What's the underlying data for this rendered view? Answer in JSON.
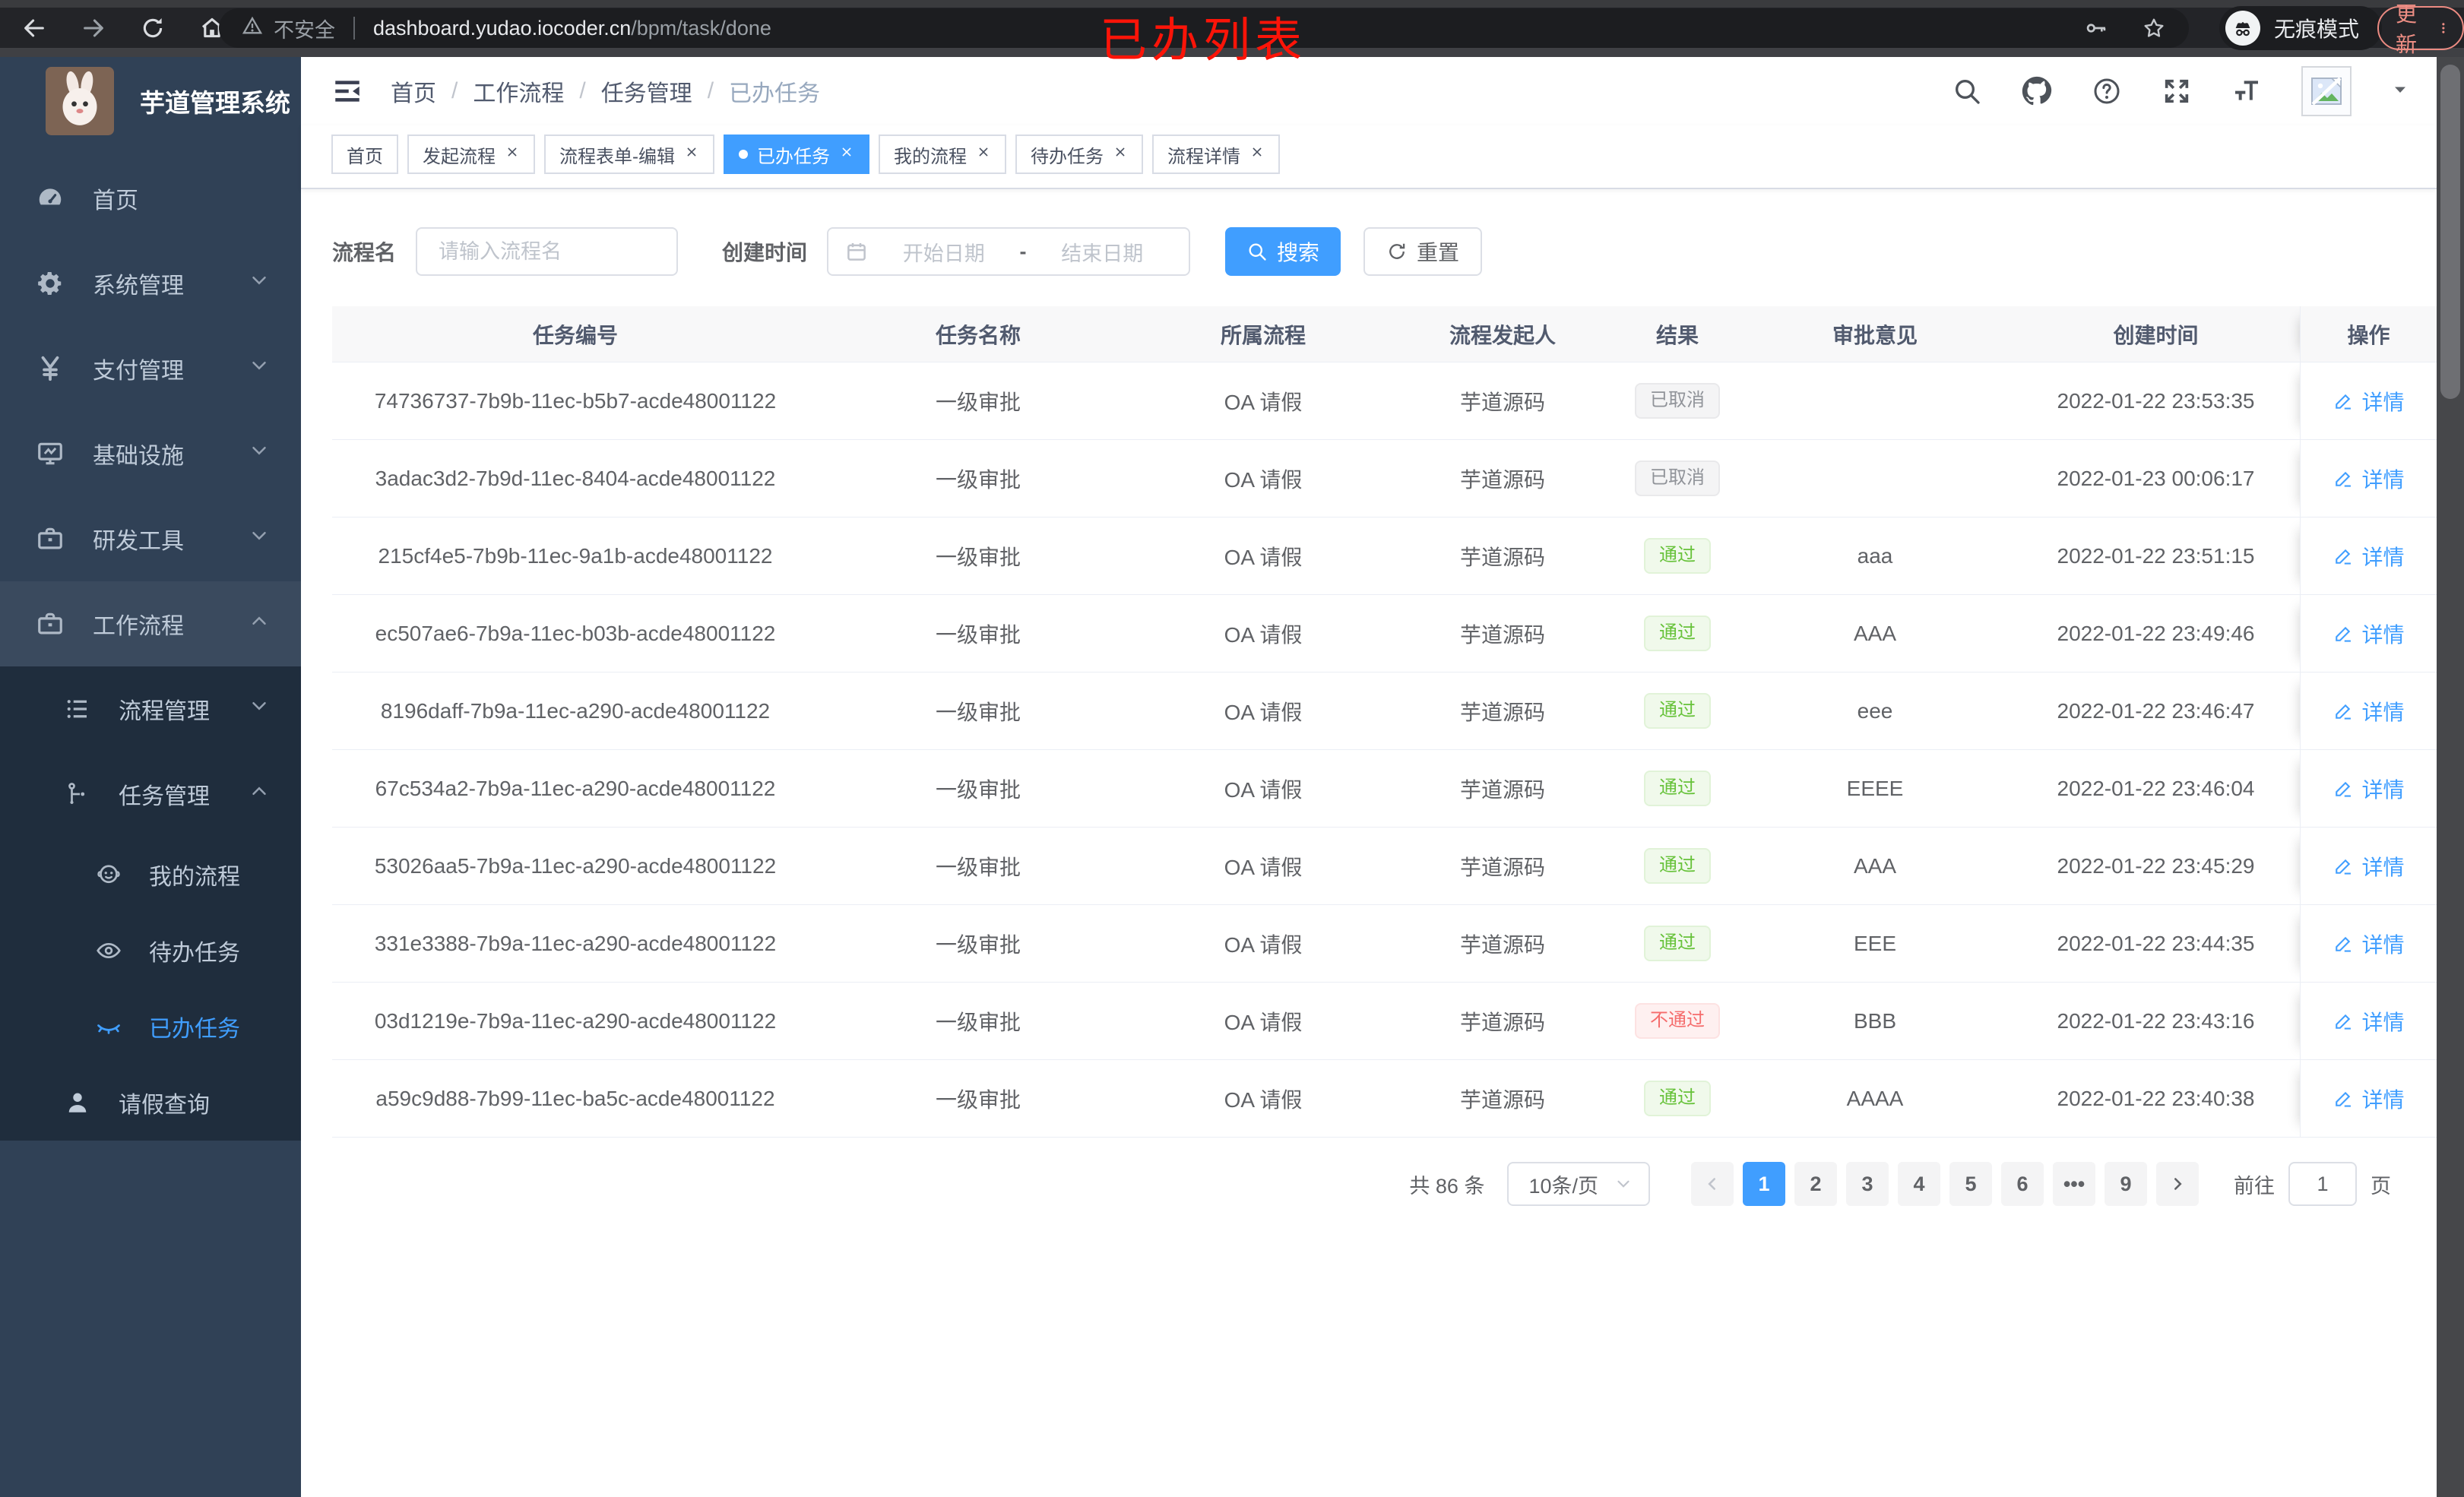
{
  "browser": {
    "security": "不安全",
    "url_domain": "dashboard.yudao.iocoder.cn",
    "url_path": "/bpm/task/done",
    "incognito": "无痕模式",
    "update": "更新"
  },
  "annotation": "已办列表",
  "colors": {
    "accent": "#409EFF",
    "success": "#67c23a",
    "danger": "#f56c6c",
    "info": "#909399",
    "sidebar_bg": "#304156",
    "submenu_bg": "#1f2d3d"
  },
  "sidebar": {
    "title": "芋道管理系统",
    "menu": {
      "home": "首页",
      "system": "系统管理",
      "pay": "支付管理",
      "infra": "基础设施",
      "dev": "研发工具",
      "workflow": "工作流程",
      "process_mgmt": "流程管理",
      "task_mgmt": "任务管理",
      "my_process": "我的流程",
      "todo": "待办任务",
      "done": "已办任务",
      "leave_query": "请假查询"
    }
  },
  "header": {
    "breadcrumb": [
      "首页",
      "工作流程",
      "任务管理",
      "已办任务"
    ]
  },
  "tabs": [
    {
      "label": "首页"
    },
    {
      "label": "发起流程"
    },
    {
      "label": "流程表单-编辑"
    },
    {
      "label": "已办任务"
    },
    {
      "label": "我的流程"
    },
    {
      "label": "待办任务"
    },
    {
      "label": "流程详情"
    }
  ],
  "filters": {
    "name_label": "流程名",
    "name_placeholder": "请输入流程名",
    "date_label": "创建时间",
    "date_start": "开始日期",
    "date_sep": "-",
    "date_end": "结束日期",
    "search": "搜索",
    "reset": "重置"
  },
  "table": {
    "columns": [
      "任务编号",
      "任务名称",
      "所属流程",
      "流程发起人",
      "结果",
      "审批意见",
      "创建时间",
      "操作"
    ],
    "action": "详情",
    "rows": [
      {
        "id": "74736737-7b9b-11ec-b5b7-acde48001122",
        "name": "一级审批",
        "flow": "OA 请假",
        "starter": "芋道源码",
        "result": "已取消",
        "result_type": "info",
        "comment": "",
        "time": "2022-01-22 23:53:35"
      },
      {
        "id": "3adac3d2-7b9d-11ec-8404-acde48001122",
        "name": "一级审批",
        "flow": "OA 请假",
        "starter": "芋道源码",
        "result": "已取消",
        "result_type": "info",
        "comment": "",
        "time": "2022-01-23 00:06:17"
      },
      {
        "id": "215cf4e5-7b9b-11ec-9a1b-acde48001122",
        "name": "一级审批",
        "flow": "OA 请假",
        "starter": "芋道源码",
        "result": "通过",
        "result_type": "success",
        "comment": "aaa",
        "time": "2022-01-22 23:51:15"
      },
      {
        "id": "ec507ae6-7b9a-11ec-b03b-acde48001122",
        "name": "一级审批",
        "flow": "OA 请假",
        "starter": "芋道源码",
        "result": "通过",
        "result_type": "success",
        "comment": "AAA",
        "time": "2022-01-22 23:49:46"
      },
      {
        "id": "8196daff-7b9a-11ec-a290-acde48001122",
        "name": "一级审批",
        "flow": "OA 请假",
        "starter": "芋道源码",
        "result": "通过",
        "result_type": "success",
        "comment": "eee",
        "time": "2022-01-22 23:46:47"
      },
      {
        "id": "67c534a2-7b9a-11ec-a290-acde48001122",
        "name": "一级审批",
        "flow": "OA 请假",
        "starter": "芋道源码",
        "result": "通过",
        "result_type": "success",
        "comment": "EEEE",
        "time": "2022-01-22 23:46:04"
      },
      {
        "id": "53026aa5-7b9a-11ec-a290-acde48001122",
        "name": "一级审批",
        "flow": "OA 请假",
        "starter": "芋道源码",
        "result": "通过",
        "result_type": "success",
        "comment": "AAA",
        "time": "2022-01-22 23:45:29"
      },
      {
        "id": "331e3388-7b9a-11ec-a290-acde48001122",
        "name": "一级审批",
        "flow": "OA 请假",
        "starter": "芋道源码",
        "result": "通过",
        "result_type": "success",
        "comment": "EEE",
        "time": "2022-01-22 23:44:35"
      },
      {
        "id": "03d1219e-7b9a-11ec-a290-acde48001122",
        "name": "一级审批",
        "flow": "OA 请假",
        "starter": "芋道源码",
        "result": "不通过",
        "result_type": "danger",
        "comment": "BBB",
        "time": "2022-01-22 23:43:16"
      },
      {
        "id": "a59c9d88-7b99-11ec-ba5c-acde48001122",
        "name": "一级审批",
        "flow": "OA 请假",
        "starter": "芋道源码",
        "result": "通过",
        "result_type": "success",
        "comment": "AAAA",
        "time": "2022-01-22 23:40:38"
      }
    ]
  },
  "pagination": {
    "total": "共 86 条",
    "size": "10条/页",
    "pages": [
      "1",
      "2",
      "3",
      "4",
      "5",
      "6",
      "9"
    ],
    "ellipsis": "•••",
    "goto_label": "前往",
    "goto_value": "1",
    "unit": "页"
  }
}
